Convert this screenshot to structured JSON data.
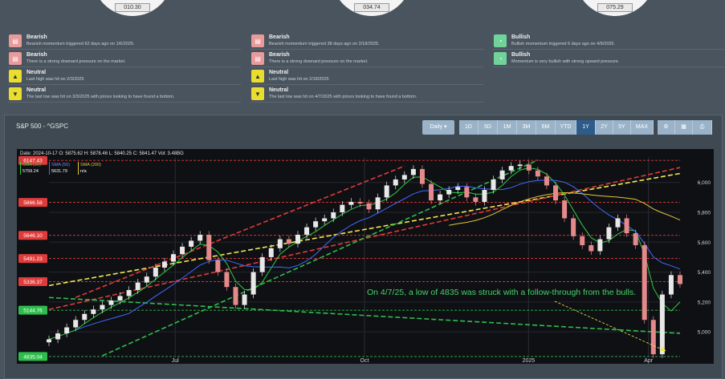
{
  "gauges": [
    {
      "value": "010.30"
    },
    {
      "value": "034.74"
    },
    {
      "value": "075.29"
    }
  ],
  "signals": [
    [
      {
        "kind": "bear",
        "title": "Bearish",
        "desc": "Bearish momentum triggered 62 days ago on 1/6/2025."
      },
      {
        "kind": "bear",
        "title": "Bearish",
        "desc": "There is a strong downard pressure on the market."
      },
      {
        "kind": "neu",
        "title": "Neutral",
        "desc": "Last high was hit on 2/3/2025"
      },
      {
        "kind": "neu",
        "title": "Neutral",
        "desc": "The last low was hit on 3/3/2025 with prices looking to have found a bottom."
      }
    ],
    [
      {
        "kind": "bear",
        "title": "Bearish",
        "desc": "Bearish momentum triggered 38 days ago on 2/18/2025."
      },
      {
        "kind": "bear",
        "title": "Bearish",
        "desc": "There is a strong downard pressure on the market."
      },
      {
        "kind": "neu",
        "title": "Neutral",
        "desc": "Last high was hit on 2/18/2025"
      },
      {
        "kind": "neu",
        "title": "Neutral",
        "desc": "The last low was hit on 4/7/2025 with prices looking to have found a bottom."
      }
    ],
    [
      {
        "kind": "bull",
        "title": "Bullish",
        "desc": "Bullish momentum triggered 6 days ago on 4/9/2025."
      },
      {
        "kind": "bull",
        "title": "Bullish",
        "desc": "Momentum is very bullish with strong upward pressure."
      }
    ]
  ],
  "panel": {
    "title": "S&P 500 - ^GSPC",
    "interval": "Daily",
    "ranges": [
      "1D",
      "5D",
      "1M",
      "3M",
      "6M",
      "YTD",
      "1Y",
      "2Y",
      "5Y",
      "MAX"
    ],
    "active_range": "1Y"
  },
  "ohlc": "Date: 2024-10-17 O: 5875.62 H: 5878.46 L: 5840.25 C: 5841.47 Vol: 3.48BG",
  "sma_legend": [
    {
      "label": "SMA (20)",
      "value": "5759.24",
      "color": "#2ecc40"
    },
    {
      "label": "SMA (50)",
      "value": "5631.79",
      "color": "#3d6cff"
    },
    {
      "label": "SMA (200)",
      "value": "n/a",
      "color": "#e2c73a"
    }
  ],
  "chart_data": {
    "type": "line",
    "series": [
      {
        "values": [
          4950,
          4990,
          5030,
          5080,
          5120,
          5150,
          5180,
          5210,
          5240,
          5280,
          5330,
          5370,
          5430,
          5470,
          5520,
          5570,
          5610,
          5650,
          5480,
          5400,
          5300,
          5180,
          5250,
          5400,
          5500,
          5560,
          5620,
          5590,
          5650,
          5700,
          5740,
          5760,
          5800,
          5850,
          5870,
          5860,
          5820,
          5900,
          5980,
          6020,
          6050,
          6090,
          5990,
          5880,
          5920,
          5950,
          5970,
          5900,
          5870,
          5950,
          6020,
          6080,
          6110,
          6120,
          6080,
          6040,
          5980,
          5880,
          5760,
          5640,
          5580,
          5540,
          5620,
          5700,
          5760,
          5660,
          5580,
          5080,
          4850,
          5250,
          5380,
          5320
        ]
      }
    ],
    "xticks": [
      "Jul",
      "Oct",
      "2025",
      "Apr"
    ],
    "yticks": [
      "5,000",
      "5,200",
      "5,400",
      "5,600",
      "5,800",
      "6,000"
    ],
    "ylim": [
      4840,
      6170
    ],
    "price_levels": [
      {
        "label": "6147.43",
        "value": 6147.43,
        "color": "#e03b3b"
      },
      {
        "label": "5866.58",
        "value": 5866.58,
        "color": "#e03b3b"
      },
      {
        "label": "5646.10",
        "value": 5646.1,
        "color": "#e03b3b"
      },
      {
        "label": "5491.23",
        "value": 5491.23,
        "color": "#e03b3b"
      },
      {
        "label": "5336.37",
        "value": 5336.37,
        "color": "#e03b3b"
      },
      {
        "label": "5144.76",
        "value": 5144.76,
        "color": "#2ebd4c"
      },
      {
        "label": "4835.04",
        "value": 4835.04,
        "color": "#2ebd4c"
      }
    ],
    "annotation": "On 4/7/25, a low of 4835 was struck with a follow-through from the bulls."
  }
}
